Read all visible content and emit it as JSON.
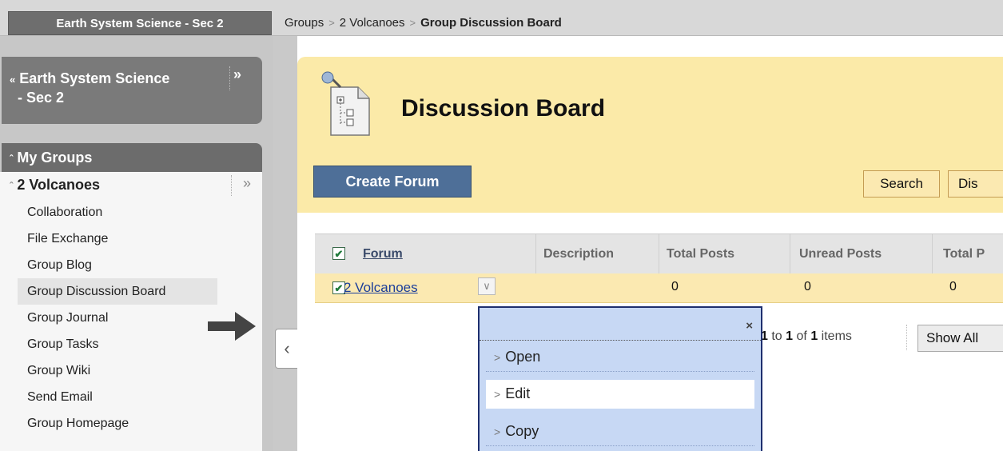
{
  "topbar": {
    "course_tab": "Earth System Science - Sec 2",
    "breadcrumb": [
      "Groups",
      "2 Volcanoes",
      "Group Discussion Board"
    ]
  },
  "left_nav": {
    "course_title_line1": "Earth System Science",
    "course_title_line2": "- Sec 2",
    "my_groups": "My Groups",
    "group_name": "2 Volcanoes",
    "items": [
      "Collaboration",
      "File Exchange",
      "Group Blog",
      "Group Discussion Board",
      "Group Journal",
      "Group Tasks",
      "Group Wiki",
      "Send Email",
      "Group Homepage"
    ],
    "active_item": "Group Discussion Board"
  },
  "main": {
    "title": "Discussion Board",
    "create_button": "Create Forum",
    "search_button": "Search",
    "partial_button": "Dis",
    "columns": [
      "Forum",
      "Description",
      "Total Posts",
      "Unread Posts",
      "Total P"
    ],
    "rows": [
      {
        "forum": "2 Volcanoes",
        "description": "",
        "total_posts": "0",
        "unread_posts": "0",
        "total_p": "0"
      }
    ],
    "pager": {
      "from": "1",
      "to_word": "to",
      "to": "1",
      "of_word": "of",
      "total": "1",
      "items_word": "items"
    },
    "show_all": "Show All"
  },
  "context_menu": {
    "close": "×",
    "items": [
      "Open",
      "Edit",
      "Copy"
    ],
    "selected": "Edit"
  },
  "colors": {
    "header_bg": "#fbeaa8",
    "primary_button": "#4e6f98",
    "menu_bg": "#c7d8f4",
    "link": "#1c3e9a"
  }
}
